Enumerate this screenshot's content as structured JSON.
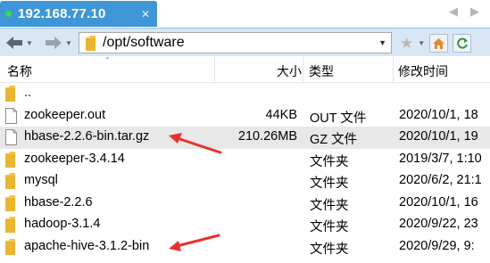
{
  "tab": {
    "title": "192.168.77.10",
    "close": "✕"
  },
  "nav": {
    "prev": "◀",
    "next": "▶"
  },
  "address": {
    "path": "/opt/software"
  },
  "columns": {
    "name": "名称",
    "size": "大小",
    "type": "类型",
    "modified": "修改时间"
  },
  "files": [
    {
      "icon": "folder-icon",
      "name": "..",
      "size": "",
      "type": "",
      "modified": ""
    },
    {
      "icon": "file-icon",
      "name": "zookeeper.out",
      "size": "44KB",
      "type": "OUT 文件",
      "modified": "2020/10/1, 18"
    },
    {
      "icon": "file-icon",
      "name": "hbase-2.2.6-bin.tar.gz",
      "size": "210.26MB",
      "type": "GZ 文件",
      "modified": "2020/10/1, 19"
    },
    {
      "icon": "folder-icon",
      "name": "zookeeper-3.4.14",
      "size": "",
      "type": "文件夹",
      "modified": "2019/3/7, 1:10"
    },
    {
      "icon": "folder-icon",
      "name": "mysql",
      "size": "",
      "type": "文件夹",
      "modified": "2020/6/2, 21:1"
    },
    {
      "icon": "folder-icon",
      "name": "hbase-2.2.6",
      "size": "",
      "type": "文件夹",
      "modified": "2020/10/1, 16"
    },
    {
      "icon": "folder-icon",
      "name": "hadoop-3.1.4",
      "size": "",
      "type": "文件夹",
      "modified": "2020/9/22, 23"
    },
    {
      "icon": "folder-icon",
      "name": "apache-hive-3.1.2-bin",
      "size": "",
      "type": "文件夹",
      "modified": "2020/9/29, 9:"
    }
  ],
  "colors": {
    "tab": "#3e96d6",
    "address_bar": "#d9e7f5",
    "folder": "#f4c542",
    "selected_row": "#e8e8e8",
    "annotation_arrow": "#e8322f"
  }
}
